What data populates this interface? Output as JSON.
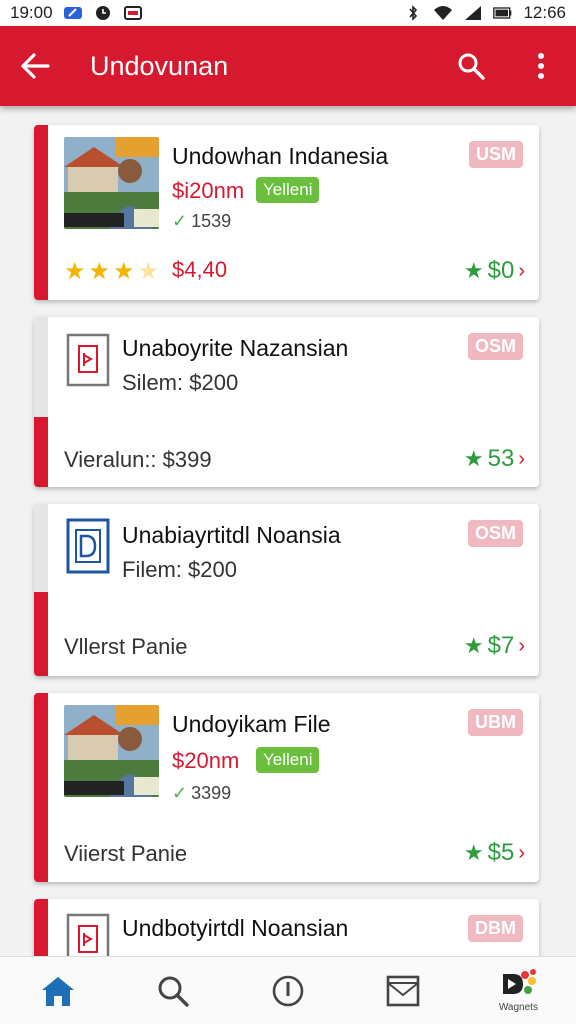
{
  "status": {
    "time_left": "19:00",
    "time_right": "12:66"
  },
  "appbar": {
    "title": "Undovunan"
  },
  "cards": [
    {
      "title": "Undowhan Indanesia",
      "price": "$i20nm",
      "badge": "Yelleni",
      "views": "1539",
      "pill": "USM",
      "footer": "$4,40",
      "rating": "$0"
    },
    {
      "title": "Unaboyrite Nazansian",
      "subtitle": "Silem: $200",
      "pill": "OSM",
      "footer": "Vieralun:: $399",
      "rating": "53"
    },
    {
      "title": "Unabiayrtitdl Noansia",
      "subtitle": "Filem: $200",
      "pill": "OSM",
      "footer": "Vllerst Panie",
      "rating": "$7"
    },
    {
      "title": "Undoyikam File",
      "price": "$20nm",
      "badge": "Yelleni",
      "views": "3399",
      "pill": "UBM",
      "footer": "Viierst Panie",
      "rating": "$5"
    },
    {
      "title": "Undbotyirtdl Noansian",
      "pill": "DBM"
    }
  ],
  "nav": {
    "wagnets_label": "Wagnets"
  },
  "colors": {
    "primary": "#d7192f",
    "success": "#2e9b3e",
    "badge": "#6abf3c"
  }
}
